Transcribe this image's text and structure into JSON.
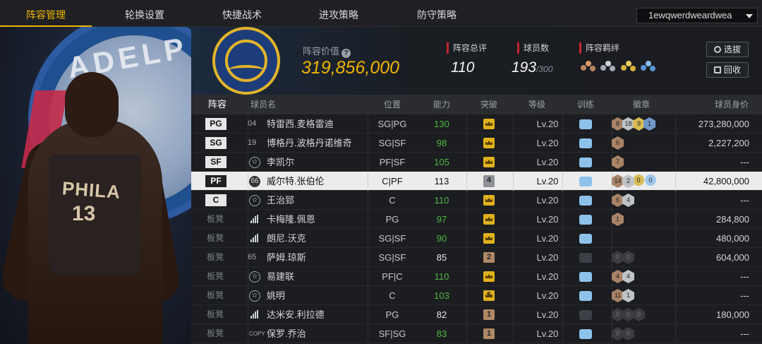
{
  "nav": {
    "tabs": [
      {
        "label": "阵容管理"
      },
      {
        "label": "轮换设置"
      },
      {
        "label": "快捷战术"
      },
      {
        "label": "进攻策略"
      },
      {
        "label": "防守策略"
      }
    ],
    "active_tab": "阵容管理",
    "account": "1ewqwerdweardwea"
  },
  "summary": {
    "value_label": "阵容价值",
    "value": "319,856,000",
    "total_rating_label": "阵容总评",
    "total_rating": "110",
    "player_count_label": "球员数",
    "player_count": "193",
    "player_count_max": "/300",
    "chemistry_label": "阵容羁绊",
    "select_button": "选拔",
    "recycle_button": "回收"
  },
  "table": {
    "headers": {
      "lineup": "阵容",
      "name": "球员名",
      "position": "位置",
      "ability": "能力",
      "breakthrough": "突破",
      "level": "等级",
      "training": "训练",
      "badges": "徽章",
      "value": "球员身价"
    },
    "rows": [
      {
        "slot": "PG",
        "jersey": "04",
        "name": "特雷西.麦格雷迪",
        "pos": "SG|PG",
        "ability": "130",
        "break": "crown",
        "level": "Lv.20",
        "value": "273,280,000",
        "badges": [
          "8",
          "18",
          "9",
          "1"
        ]
      },
      {
        "slot": "SG",
        "jersey": "19",
        "name": "博格丹.波格丹诺维奇",
        "pos": "SG|SF",
        "ability": "98",
        "break": "crown",
        "level": "Lv.20",
        "value": "2,227,200",
        "badges": [
          "6"
        ]
      },
      {
        "slot": "SF",
        "jersey": "",
        "name": "李凯尔",
        "pos": "PF|SF",
        "ability": "105",
        "break": "crown",
        "level": "Lv.20",
        "value": "---",
        "badges": [
          "7"
        ]
      },
      {
        "slot": "PF",
        "jersey": "66",
        "name": "威尔特.张伯伦",
        "pos": "C|PF",
        "ability": "113",
        "break": "4",
        "level": "Lv.20",
        "value": "42,800,000",
        "badges": [
          "14",
          "2",
          "0",
          "0"
        ]
      },
      {
        "slot": "C",
        "jersey": "",
        "name": "王治郅",
        "pos": "C",
        "ability": "110",
        "break": "crown",
        "level": "Lv.20",
        "value": "---",
        "badges": [
          "6",
          "4"
        ]
      },
      {
        "slot": "板凳",
        "jersey": "",
        "name": "卡梅隆.佩恩",
        "pos": "PG",
        "ability": "97",
        "break": "crown",
        "level": "Lv.20",
        "value": "284,800",
        "badges": [
          "1"
        ]
      },
      {
        "slot": "板凳",
        "jersey": "",
        "name": "朗尼.沃克",
        "pos": "SG|SF",
        "ability": "90",
        "break": "crown",
        "level": "Lv.20",
        "value": "480,000",
        "badges": []
      },
      {
        "slot": "板凳",
        "jersey": "65",
        "name": "萨姆.琼斯",
        "pos": "SG|SF",
        "ability": "85",
        "break": "2",
        "level": "Lv.20",
        "value": "604,000",
        "badges": [
          "0",
          "0"
        ]
      },
      {
        "slot": "板凳",
        "jersey": "",
        "name": "易建联",
        "pos": "PF|C",
        "ability": "110",
        "break": "crown",
        "level": "Lv.20",
        "value": "---",
        "badges": [
          "4",
          "4"
        ]
      },
      {
        "slot": "板凳",
        "jersey": "",
        "name": "姚明",
        "pos": "C",
        "ability": "103",
        "break": "5",
        "level": "Lv.20",
        "value": "---",
        "badges": [
          "11",
          "1"
        ]
      },
      {
        "slot": "板凳",
        "jersey": "",
        "name": "达米安.利拉德",
        "pos": "PG",
        "ability": "82",
        "break": "1",
        "level": "Lv.20",
        "value": "180,000",
        "badges": [
          "0",
          "0",
          "0"
        ]
      },
      {
        "slot": "板凳",
        "jersey": "COPY",
        "name": "保罗.乔治",
        "pos": "SF|SG",
        "ability": "83",
        "break": "1",
        "level": "Lv.20",
        "value": "---",
        "badges": [
          "0",
          "0"
        ]
      }
    ]
  },
  "art": {
    "team_logo_text": "ADELP",
    "jersey_text": "PHILA",
    "jersey_number": "13"
  },
  "colors": {
    "accent": "#f0b400",
    "ability_green": "#52b742",
    "stat_marker_red": "#c3262e"
  }
}
